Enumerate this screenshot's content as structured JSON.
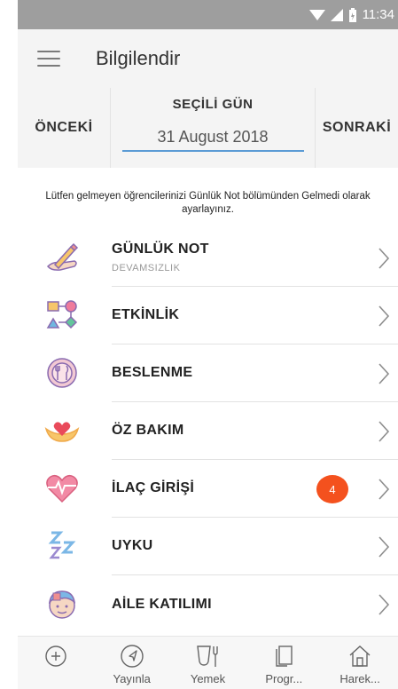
{
  "status": {
    "time": "11:34"
  },
  "header": {
    "title": "Bilgilendir"
  },
  "date_selector": {
    "prev_label": "ÖNCEKİ",
    "center_label": "SEÇİLİ GÜN",
    "date_value": "31 August 2018",
    "next_label": "SONRAKİ"
  },
  "notice": "Lütfen gelmeyen öğrencilerinizi Günlük Not bölümünden Gelmedi olarak ayarlayınız.",
  "items": [
    {
      "label": "GÜNLÜK NOT",
      "sub": "DEVAMSIZLIK",
      "icon": "pencil-hand-icon"
    },
    {
      "label": "ETKİNLİK",
      "icon": "activity-shapes-icon"
    },
    {
      "label": "BESLENME",
      "icon": "plate-cutlery-icon"
    },
    {
      "label": "ÖZ BAKIM",
      "icon": "heart-hands-icon"
    },
    {
      "label": "İLAÇ GİRİŞİ",
      "badge": "4",
      "icon": "heartbeat-icon"
    },
    {
      "label": "UYKU",
      "icon": "sleep-zzz-icon"
    },
    {
      "label": "AİLE KATILIMI",
      "icon": "family-face-icon"
    }
  ],
  "bottom_nav": [
    {
      "label": "",
      "icon": "plus-circle-icon"
    },
    {
      "label": "Yayınla",
      "icon": "navigation-arrow-icon"
    },
    {
      "label": "Yemek",
      "icon": "cup-fork-icon"
    },
    {
      "label": "Progr...",
      "icon": "program-pages-icon"
    },
    {
      "label": "Harek...",
      "icon": "home-icon"
    }
  ],
  "colors": {
    "accent_underline": "#5b9bd5",
    "badge": "#f4511e",
    "statusbar": "#9e9e9e"
  }
}
